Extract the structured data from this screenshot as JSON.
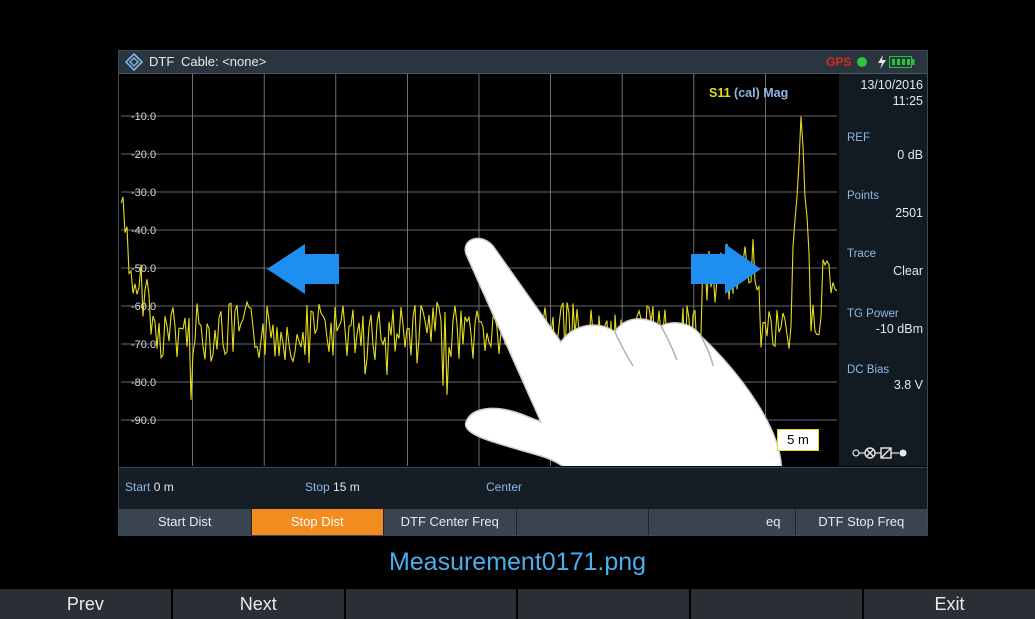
{
  "titlebar": {
    "mode": "DTF",
    "cable": "Cable: <none>",
    "gps": "GPS",
    "colors": {
      "gps": "#e0251f",
      "gps_dot": "#2fc13a",
      "battery": "#27c53a"
    }
  },
  "plot": {
    "trace_label_s11": "S11",
    "trace_label_rest": "(cal) Mag",
    "y_ticks": [
      "-10.0",
      "-20.0",
      "-30.0",
      "-40.0",
      "-50.0",
      "-60.0",
      "-70.0",
      "-80.0",
      "-90.0"
    ],
    "marker_value": "5 m",
    "trace_color": "#e6dc1e",
    "grid_color": "#8a8a8a"
  },
  "side": {
    "date": "13/10/2016",
    "time": "11:25",
    "ref_label": "REF",
    "ref_value": "0 dB",
    "points_label": "Points",
    "points_value": "2501",
    "trace_label": "Trace",
    "trace_value": "Clear",
    "tg_label": "TG Power",
    "tg_value": "-10 dBm",
    "dc_label": "DC Bias",
    "dc_value": "3.8 V"
  },
  "freqbar": {
    "start_label": "Start",
    "start_value": "0 m",
    "stop_label": "Stop",
    "stop_value": "15 m",
    "center_label": "Center"
  },
  "softkeys": [
    "Start Dist",
    "Stop Dist",
    "DTF Center Freq",
    "",
    "eq",
    "DTF Stop Freq"
  ],
  "filename": "Measurement0171.png",
  "hwkeys": [
    "Prev",
    "Next",
    "",
    "",
    "",
    "Exit"
  ],
  "accent": {
    "softkey_active": "#f28c1e",
    "arrow": "#1e8ff0",
    "filename": "#4aaef0"
  }
}
